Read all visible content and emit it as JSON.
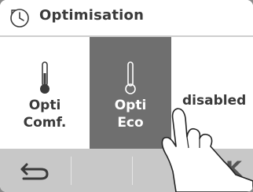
{
  "header": {
    "title": "Optimisation",
    "icon": "clock-icon"
  },
  "options": [
    {
      "line1": "Opti",
      "line2": "Comf.",
      "icon": "thermometer-icon",
      "selected": false
    },
    {
      "line1": "Opti",
      "line2": "Eco",
      "icon": "thermometer-icon",
      "selected": true
    },
    {
      "label": "disabled",
      "selected": false
    }
  ],
  "footer": {
    "back_icon": "back-arrow-icon",
    "ok_label": "OK"
  },
  "colors": {
    "selected_bg": "#6f6f6f",
    "footer_bg": "#c8c8c8",
    "text": "#3a3a3a"
  }
}
